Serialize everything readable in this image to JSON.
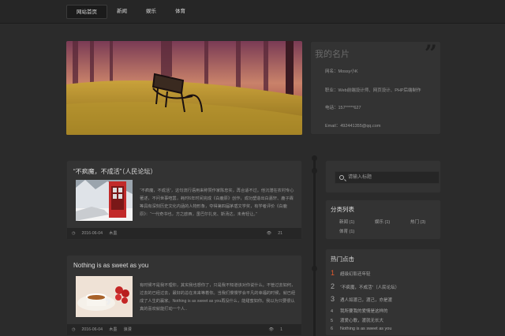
{
  "nav": {
    "items": [
      "网站首页",
      "新闻",
      "娱乐",
      "体育"
    ]
  },
  "card": {
    "title": "我的名片",
    "lines": [
      "网名：Mossy小K",
      "职业：Web前端设计师、网页设计、PHP后端制作",
      "电话：157*****627",
      "Email：492441355@qq.com"
    ]
  },
  "posts": [
    {
      "title": "“不疯魔，不成活”（人民论坛）",
      "text": "“不疯魔，不成活”，这句流行语用来称赞作家陈忠实，再合适不过。他沉潜在农村专心著述，不问世事喧嚣，耗时6年时间完成《白鹿原》创作，成功塑造出白嘉轩、鹿子霖等具有深刻历史文化内涵的人物形象，夺得第四届茅盾文学奖，有学者评价《白鹿原》：“一代奇书也，方之欧西，虽巴尔扎克、斯汤达，未肯轻让。”",
      "date": "2016-06-04",
      "author": "木墨",
      "count": "21"
    },
    {
      "title": "Nothing is as sweet as you",
      "text": "有时候不是我不理你，其实我也想你了，只是我不知道该对你说什么。不管过去如何，过去的已经过去，最好的总在未来等着你。当我们慢慢学会平凡的幸福的时候，就已经成了人生的赢家。Nothing is as sweet as you再没什么，能甜蜜如你。我以为只要很认真的喜欢就能打动一个人..",
      "date": "2016-06-04",
      "author": "木墨",
      "tag": "浪漫",
      "count": "1"
    }
  ],
  "search": {
    "placeholder": "请输入标题"
  },
  "categories": {
    "title": "分类列表",
    "items": [
      "新闻 (1)",
      "娱乐 (1)",
      "热门 (3)",
      "体育 (1)"
    ]
  },
  "hot": {
    "title": "热门点击",
    "items": [
      {
        "num": "1",
        "text": "超级幻影还年轻"
      },
      {
        "num": "2",
        "text": "“不疯魔，不成活”（人民论坛）"
      },
      {
        "num": "3",
        "text": "遇人如渡己，渡己，亦是渡"
      },
      {
        "num": "4",
        "text": "我所要我的爱情是这样的"
      },
      {
        "num": "5",
        "text": "渡爱心歌，渡就无长大"
      },
      {
        "num": "6",
        "text": "Nothing is as sweet as you"
      }
    ]
  },
  "colors": {
    "accent": "#e05a2f",
    "background": "#2b2b2b",
    "panel": "#333333"
  }
}
